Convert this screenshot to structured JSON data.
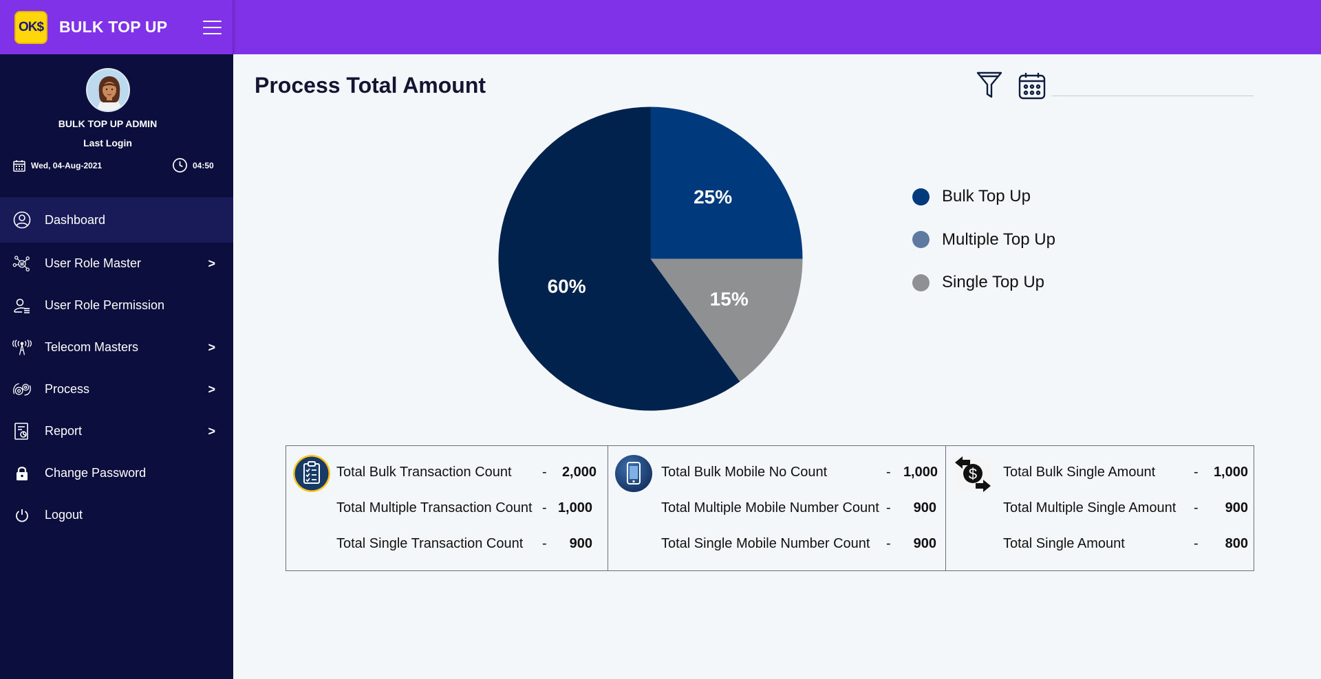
{
  "app": {
    "logo_text": "OK$",
    "title": "BULK TOP UP"
  },
  "user": {
    "name": "BULK TOP UP ADMIN",
    "last_login_label": "Last Login",
    "date": "Wed, 04-Aug-2021",
    "time": "04:50"
  },
  "menu": [
    {
      "label": "Dashboard",
      "icon": "user-circle-icon",
      "chevron": false,
      "active": true
    },
    {
      "label": "User Role Master",
      "icon": "network-icon",
      "chevron": true,
      "chevron_label": ">"
    },
    {
      "label": "User Role Permission",
      "icon": "user-list-icon",
      "chevron": false
    },
    {
      "label": "Telecom Masters",
      "icon": "antenna-tower-icon",
      "chevron": true,
      "chevron_label": ">"
    },
    {
      "label": "Process",
      "icon": "gears-icon",
      "chevron": true,
      "chevron_label": ">"
    },
    {
      "label": "Report",
      "icon": "report-icon",
      "chevron": true,
      "chevron_label": ">"
    },
    {
      "label": "Change Password",
      "icon": "lock-icon",
      "chevron": false
    },
    {
      "label": "Logout",
      "icon": "power-icon",
      "chevron": false
    }
  ],
  "main": {
    "title": "Process Total Amount",
    "date_input_value": "",
    "date_input_placeholder": ""
  },
  "chart_data": {
    "type": "pie",
    "title": "",
    "slices": [
      {
        "label": "Bulk Top Up",
        "value": 25,
        "display": "25%"
      },
      {
        "label": "Single Top Up",
        "value": 15,
        "display": "15%"
      },
      {
        "label": "Multiple Top Up",
        "value": 60,
        "display": "60%"
      }
    ],
    "legend": [
      {
        "label": "Bulk Top Up",
        "color": "#003a7d"
      },
      {
        "label": "Multiple Top Up",
        "color": "#5e7aa1"
      },
      {
        "label": "Single Top Up",
        "color": "#8f9092"
      }
    ],
    "slice_colors": {
      "Bulk Top Up": "#003a7d",
      "Single Top Up": "#8f9092",
      "Multiple Top Up": "#00224c"
    },
    "legend_placement": "right"
  },
  "summary": [
    {
      "icon": "clipboard-checklist-icon",
      "rows": [
        {
          "label": "Total Bulk Transaction Count",
          "dash": "-",
          "value": "2,000"
        },
        {
          "label": "Total Multiple Transaction Count",
          "dash": "-",
          "value": "1,000"
        },
        {
          "label": "Total Single Transaction Count",
          "dash": "-",
          "value": "900"
        }
      ]
    },
    {
      "icon": "mobile-phone-icon",
      "rows": [
        {
          "label": "Total Bulk Mobile No Count",
          "dash": "-",
          "value": "1,000"
        },
        {
          "label": "Total Multiple Mobile Number Count",
          "dash": "-",
          "value": "900"
        },
        {
          "label": "Total Single Mobile Number Count",
          "dash": "-",
          "value": "900"
        }
      ]
    },
    {
      "icon": "money-exchange-icon",
      "rows": [
        {
          "label": "Total Bulk Single Amount",
          "dash": "-",
          "value": "1,000"
        },
        {
          "label": "Total Multiple Single Amount",
          "dash": "-",
          "value": "900"
        },
        {
          "label": "Total Single Amount",
          "dash": "-",
          "value": "800"
        }
      ]
    }
  ],
  "colors": {
    "topbar": "#8032e8",
    "sidebar": "#0c0e3d",
    "sidebar_active": "#181b58",
    "logo": "#ffd60a"
  }
}
